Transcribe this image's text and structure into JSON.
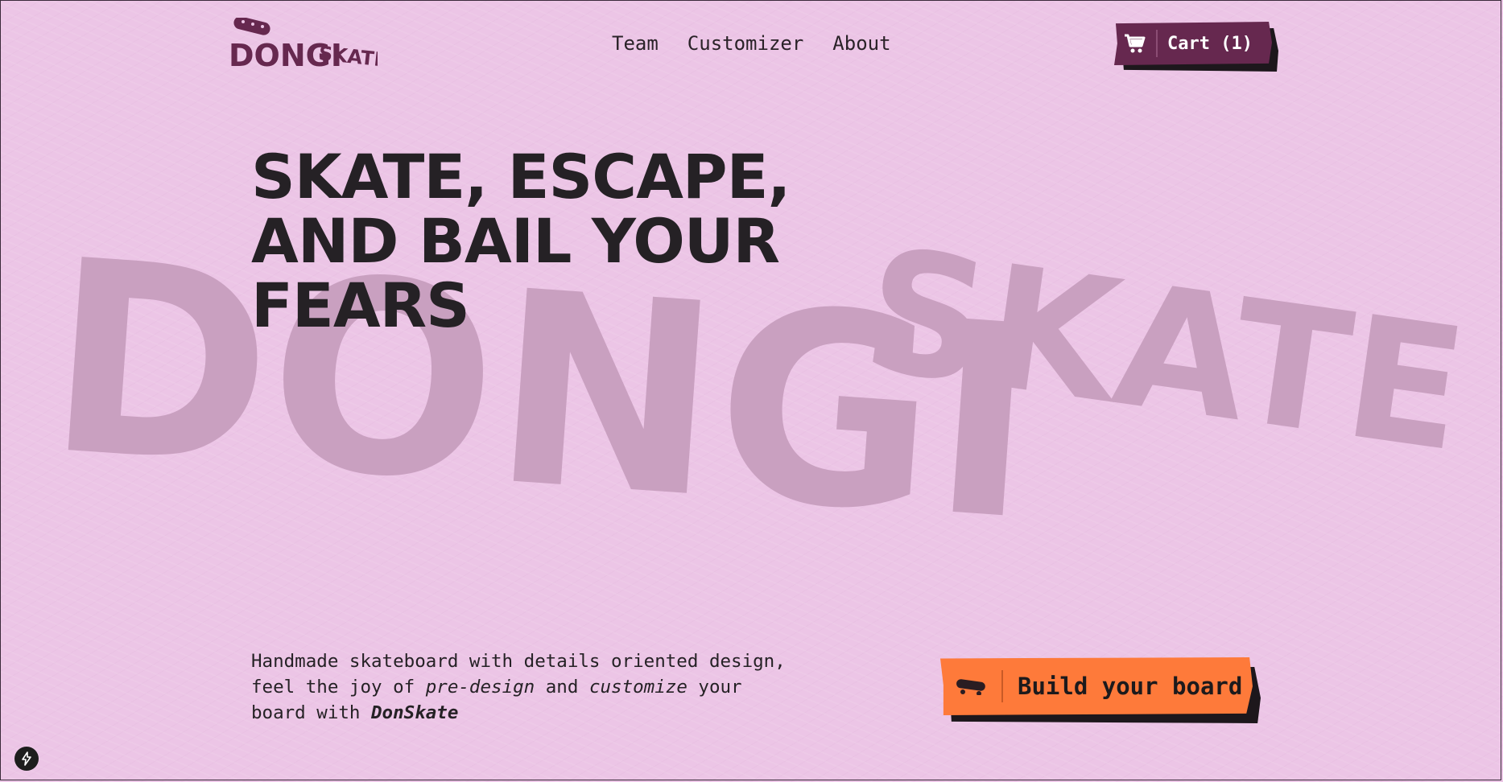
{
  "header": {
    "logo_text_main": "DONGI",
    "logo_text_sub": "SKATE",
    "nav": [
      {
        "label": "Team"
      },
      {
        "label": "Customizer"
      },
      {
        "label": "About"
      }
    ],
    "cart_label": "Cart (1)"
  },
  "hero": {
    "watermark_main": "DONGI",
    "watermark_sub": "SKATE",
    "headline": [
      "SKATE, ESCAPE,",
      "AND BAIL YOUR",
      "FEARS"
    ],
    "description": {
      "part1": "Handmade skateboard with details oriented design, feel the joy of ",
      "em1": "pre-design",
      "part2": " and ",
      "em2": "customize",
      "part3": " your board with ",
      "brand": "DonSkate"
    },
    "cta_label": "Build your board"
  },
  "icons": {
    "cart": "cart-icon",
    "cta": "skateboard-icon",
    "badge": "lightning-icon"
  },
  "colors": {
    "background": "#ecc5e6",
    "brand_purple": "#66284f",
    "cta_orange": "#fe7a3a",
    "text_dark": "#252125",
    "watermark": "#c9a0c0"
  }
}
